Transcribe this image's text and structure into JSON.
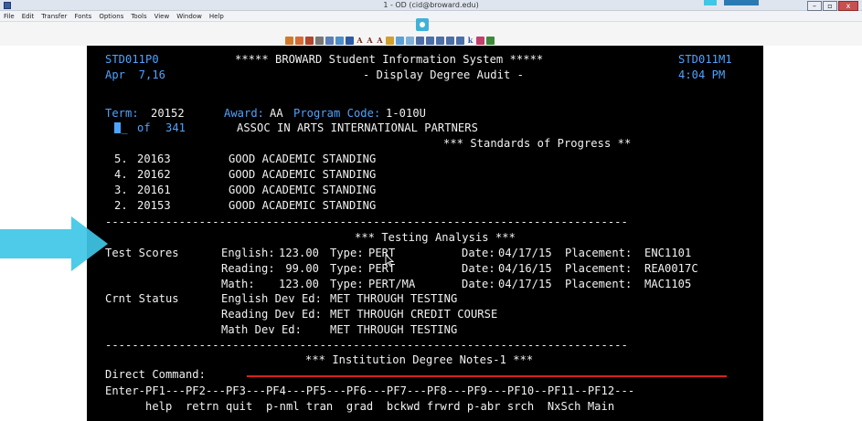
{
  "window": {
    "title": "1 - OD (cid@broward.edu)"
  },
  "menu": {
    "items": [
      "File",
      "Edit",
      "Transfer",
      "Fonts",
      "Options",
      "Tools",
      "View",
      "Window",
      "Help"
    ]
  },
  "screen": {
    "header": {
      "left_id": "STD011P0",
      "system_title": "***** BROWARD Student Information System *****",
      "right_id": "STD011M1",
      "date": "Apr  7,16",
      "subtitle": "- Display Degree Audit -",
      "time": "4:04 PM"
    },
    "term": {
      "label": "Term:",
      "value": "20152",
      "award_label": "Award:",
      "award_value": "AA",
      "program_label": "Program Code:",
      "program_value": "1-010U"
    },
    "page_counter": {
      "current": "1_",
      "of_label": "of",
      "total": "341",
      "program_name": "ASSOC IN ARTS INTERNATIONAL PARTNERS"
    },
    "progress_heading": "*** Standards of Progress **",
    "progress_rows": [
      {
        "num": "5.",
        "term": "20163",
        "status": "GOOD ACADEMIC STANDING"
      },
      {
        "num": "4.",
        "term": "20162",
        "status": "GOOD ACADEMIC STANDING"
      },
      {
        "num": "3.",
        "term": "20161",
        "status": "GOOD ACADEMIC STANDING"
      },
      {
        "num": "2.",
        "term": "20153",
        "status": "GOOD ACADEMIC STANDING"
      }
    ],
    "divider": "------------------------------------------------------------------------------",
    "testing_heading": "*** Testing Analysis ***",
    "test_scores_label": "Test Scores",
    "test_scores": [
      {
        "subject": "English:",
        "score": "123.00",
        "type_label": "Type:",
        "type": "PERT",
        "date_label": "Date:",
        "date": "04/17/15",
        "placement_label": "Placement:",
        "placement": "ENC1101"
      },
      {
        "subject": "Reading:",
        "score": " 99.00",
        "type_label": "Type:",
        "type": "PERT",
        "date_label": "Date:",
        "date": "04/16/15",
        "placement_label": "Placement:",
        "placement": "REA0017C"
      },
      {
        "subject": "Math:   ",
        "score": "123.00",
        "type_label": "Type:",
        "type": "PERT/MA",
        "date_label": "Date:",
        "date": "04/17/15",
        "placement_label": "Placement:",
        "placement": "MAC1105"
      }
    ],
    "crnt_status_label": "Crnt Status",
    "crnt_status": [
      {
        "label": "English Dev Ed:",
        "value": "MET THROUGH TESTING"
      },
      {
        "label": "Reading Dev Ed:",
        "value": "MET THROUGH CREDIT COURSE"
      },
      {
        "label": "Math Dev Ed:   ",
        "value": "MET THROUGH TESTING"
      }
    ],
    "institution_heading": "*** Institution Degree Notes-1 ***",
    "direct_command_label": "Direct Command:",
    "pf_line": "Enter-PF1---PF2---PF3---PF4---PF5---PF6---PF7---PF8---PF9---PF10--PF11--PF12---",
    "pf_labels_line": "      help  retrn quit  p-nml tran  grad  bckwd frwrd p-abr srch  NxSch Main"
  },
  "colors": {
    "terminal_bg": "#000000",
    "terminal_text": "#f2f2f2",
    "terminal_accent": "#4fa3ff",
    "command_underline": "#d4231c",
    "arrow": "#3fc7e6"
  },
  "icons": {
    "arrow": "right-arrow-icon",
    "app": "terminal-app-icon"
  }
}
